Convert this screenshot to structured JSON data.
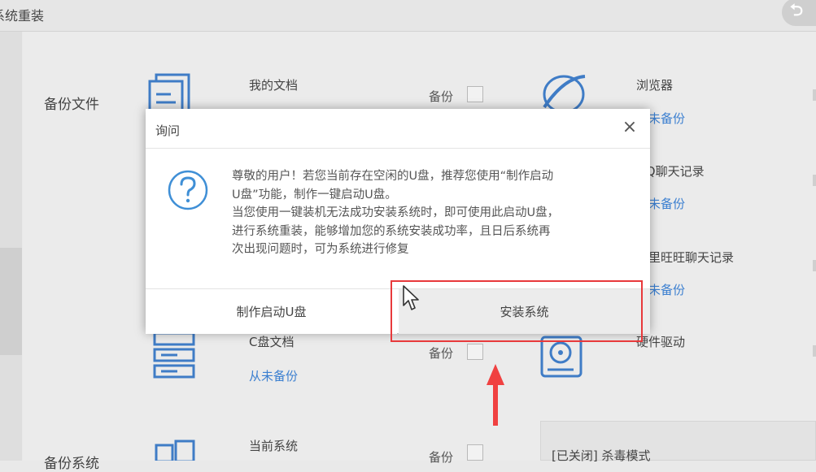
{
  "window": {
    "title": "系统重装",
    "back_icon": "back-arrow-icon"
  },
  "backup_files": {
    "section_title": "备份文件",
    "items": [
      {
        "name": "我的文档",
        "checkbox_label": "备份"
      },
      {
        "name": "浏览器",
        "status": "从未备份"
      },
      {
        "name": "QQ聊天记录",
        "status": "从未备份"
      },
      {
        "name": "阿里旺旺聊天记录",
        "status": "从未备份"
      },
      {
        "name": "C盘文档",
        "status": "从未备份",
        "checkbox_label": "备份"
      },
      {
        "name": "硬件驱动"
      }
    ]
  },
  "backup_system": {
    "section_title": "备份系统",
    "items": [
      {
        "name": "当前系统",
        "checkbox_label": "备份"
      }
    ],
    "antivirus": "[已关闭] 杀毒模式"
  },
  "dialog": {
    "title": "询问",
    "close": "×",
    "icon": "question-icon",
    "message": [
      "尊敬的用户！若您当前存在空闲的U盘，推荐您使用“制作启动",
      "U盘”功能，制作一键启动U盘。",
      "当您使用一键装机无法成功安装系统时，即可使用此启动U盘，",
      "进行系统重装，能够增加您的系统安装成功率，且日后系统再",
      "次出现问题时，可为系统进行修复"
    ],
    "btn_make": "制作启动U盘",
    "btn_install": "安装系统"
  },
  "colors": {
    "accent_blue": "#3b7fd0",
    "highlight_red": "#e8393b"
  }
}
